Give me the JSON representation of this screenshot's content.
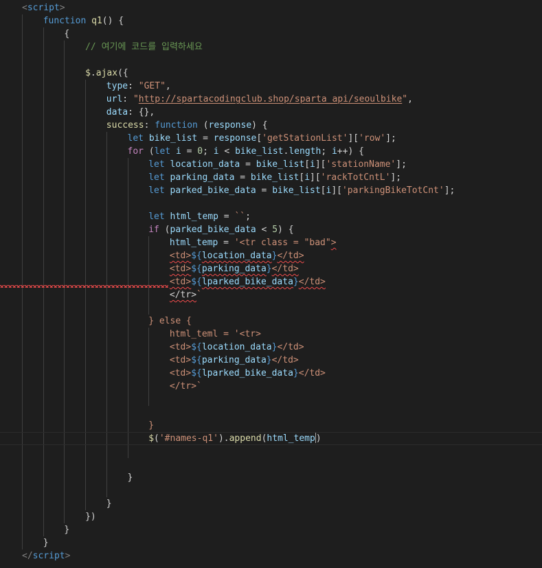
{
  "theme": {
    "background": "#1e1e1e",
    "text": "#d4d4d4",
    "tag": "#569cd6",
    "keyword": "#569cd6",
    "control": "#c586c0",
    "function": "#dcdcaa",
    "variable": "#9cdcfe",
    "string": "#ce9178",
    "number": "#b5cea8",
    "comment": "#6a9955",
    "error": "#f14c4c"
  },
  "code_lines": [
    {
      "indent": 0,
      "tokens": [
        {
          "t": "<",
          "c": "tag-punct"
        },
        {
          "t": "script",
          "c": "tag"
        },
        {
          "t": ">",
          "c": "tag-punct"
        }
      ]
    },
    {
      "indent": 1,
      "tokens": [
        {
          "t": "function",
          "c": "keyword"
        },
        {
          "t": " ",
          "c": "plain"
        },
        {
          "t": "q1",
          "c": "function"
        },
        {
          "t": "() {",
          "c": "plain"
        }
      ]
    },
    {
      "indent": 2,
      "tokens": [
        {
          "t": "{",
          "c": "plain"
        }
      ]
    },
    {
      "indent": 3,
      "tokens": [
        {
          "t": "// 여기에 코드를 입력하세요",
          "c": "comment"
        }
      ]
    },
    {
      "indent": 0,
      "tokens": []
    },
    {
      "indent": 3,
      "tokens": [
        {
          "t": "$",
          "c": "function"
        },
        {
          "t": ".",
          "c": "plain"
        },
        {
          "t": "ajax",
          "c": "function"
        },
        {
          "t": "({",
          "c": "plain"
        }
      ]
    },
    {
      "indent": 4,
      "tokens": [
        {
          "t": "type",
          "c": "variable"
        },
        {
          "t": ": ",
          "c": "plain"
        },
        {
          "t": "\"GET\"",
          "c": "string"
        },
        {
          "t": ",",
          "c": "plain"
        }
      ]
    },
    {
      "indent": 4,
      "tokens": [
        {
          "t": "url",
          "c": "variable"
        },
        {
          "t": ": ",
          "c": "plain"
        },
        {
          "t": "\"",
          "c": "string"
        },
        {
          "t": "http://spartacodingclub.shop/sparta_api/seoulbike",
          "c": "string url"
        },
        {
          "t": "\"",
          "c": "string"
        },
        {
          "t": ",",
          "c": "plain"
        }
      ]
    },
    {
      "indent": 4,
      "tokens": [
        {
          "t": "data",
          "c": "variable"
        },
        {
          "t": ": {},",
          "c": "plain"
        }
      ]
    },
    {
      "indent": 4,
      "tokens": [
        {
          "t": "success",
          "c": "function"
        },
        {
          "t": ": ",
          "c": "plain"
        },
        {
          "t": "function",
          "c": "keyword"
        },
        {
          "t": " (",
          "c": "plain"
        },
        {
          "t": "response",
          "c": "variable"
        },
        {
          "t": ") {",
          "c": "plain"
        }
      ]
    },
    {
      "indent": 5,
      "tokens": [
        {
          "t": "let",
          "c": "keyword"
        },
        {
          "t": " ",
          "c": "plain"
        },
        {
          "t": "bike_list",
          "c": "variable"
        },
        {
          "t": " = ",
          "c": "plain"
        },
        {
          "t": "response",
          "c": "variable"
        },
        {
          "t": "[",
          "c": "plain"
        },
        {
          "t": "'getStationList'",
          "c": "string"
        },
        {
          "t": "][",
          "c": "plain"
        },
        {
          "t": "'row'",
          "c": "string"
        },
        {
          "t": "];",
          "c": "plain"
        }
      ]
    },
    {
      "indent": 5,
      "tokens": [
        {
          "t": "for",
          "c": "control"
        },
        {
          "t": " (",
          "c": "plain"
        },
        {
          "t": "let",
          "c": "keyword"
        },
        {
          "t": " ",
          "c": "plain"
        },
        {
          "t": "i",
          "c": "variable"
        },
        {
          "t": " = ",
          "c": "plain"
        },
        {
          "t": "0",
          "c": "number"
        },
        {
          "t": "; ",
          "c": "plain"
        },
        {
          "t": "i",
          "c": "variable"
        },
        {
          "t": " < ",
          "c": "plain"
        },
        {
          "t": "bike_list",
          "c": "variable"
        },
        {
          "t": ".",
          "c": "plain"
        },
        {
          "t": "length",
          "c": "variable"
        },
        {
          "t": "; ",
          "c": "plain"
        },
        {
          "t": "i",
          "c": "variable"
        },
        {
          "t": "++) {",
          "c": "plain"
        }
      ]
    },
    {
      "indent": 6,
      "tokens": [
        {
          "t": "let",
          "c": "keyword"
        },
        {
          "t": " ",
          "c": "plain"
        },
        {
          "t": "location_data",
          "c": "variable"
        },
        {
          "t": " = ",
          "c": "plain"
        },
        {
          "t": "bike_list",
          "c": "variable"
        },
        {
          "t": "[",
          "c": "plain"
        },
        {
          "t": "i",
          "c": "variable"
        },
        {
          "t": "][",
          "c": "plain"
        },
        {
          "t": "'stationName'",
          "c": "string"
        },
        {
          "t": "];",
          "c": "plain"
        }
      ]
    },
    {
      "indent": 6,
      "tokens": [
        {
          "t": "let",
          "c": "keyword"
        },
        {
          "t": " ",
          "c": "plain"
        },
        {
          "t": "parking_data",
          "c": "variable"
        },
        {
          "t": " = ",
          "c": "plain"
        },
        {
          "t": "bike_list",
          "c": "variable"
        },
        {
          "t": "[",
          "c": "plain"
        },
        {
          "t": "i",
          "c": "variable"
        },
        {
          "t": "][",
          "c": "plain"
        },
        {
          "t": "'rackTotCntL'",
          "c": "string"
        },
        {
          "t": "];",
          "c": "plain"
        }
      ]
    },
    {
      "indent": 6,
      "tokens": [
        {
          "t": "let",
          "c": "keyword"
        },
        {
          "t": " ",
          "c": "plain"
        },
        {
          "t": "parked_bike_data",
          "c": "variable"
        },
        {
          "t": " = ",
          "c": "plain"
        },
        {
          "t": "bike_list",
          "c": "variable"
        },
        {
          "t": "[",
          "c": "plain"
        },
        {
          "t": "i",
          "c": "variable"
        },
        {
          "t": "][",
          "c": "plain"
        },
        {
          "t": "'parkingBikeTotCnt'",
          "c": "string"
        },
        {
          "t": "];",
          "c": "plain"
        }
      ]
    },
    {
      "indent": 0,
      "tokens": []
    },
    {
      "indent": 6,
      "tokens": [
        {
          "t": "let",
          "c": "keyword"
        },
        {
          "t": " ",
          "c": "plain"
        },
        {
          "t": "html_temp",
          "c": "variable"
        },
        {
          "t": " = ",
          "c": "plain"
        },
        {
          "t": "``",
          "c": "string"
        },
        {
          "t": ";",
          "c": "plain"
        }
      ]
    },
    {
      "indent": 6,
      "tokens": [
        {
          "t": "if",
          "c": "control"
        },
        {
          "t": " (",
          "c": "plain"
        },
        {
          "t": "parked_bike_data",
          "c": "variable"
        },
        {
          "t": " < ",
          "c": "plain"
        },
        {
          "t": "5",
          "c": "number"
        },
        {
          "t": ") {",
          "c": "plain"
        }
      ]
    },
    {
      "indent": 7,
      "tokens": [
        {
          "t": "html_temp",
          "c": "variable"
        },
        {
          "t": " = ",
          "c": "plain"
        },
        {
          "t": "'<tr class = \"bad\"",
          "c": "string"
        },
        {
          "t": ">",
          "c": "string squiggle"
        }
      ]
    },
    {
      "indent": 7,
      "tokens": [
        {
          "t": "<td>",
          "c": "string squiggle"
        },
        {
          "t": "${",
          "c": "keyword"
        },
        {
          "t": "location_data",
          "c": "variable squiggle"
        },
        {
          "t": "}",
          "c": "keyword"
        },
        {
          "t": "</td>",
          "c": "string squiggle"
        }
      ]
    },
    {
      "indent": 7,
      "tokens": [
        {
          "t": "<td>",
          "c": "string squiggle"
        },
        {
          "t": "${",
          "c": "keyword"
        },
        {
          "t": "parking_data",
          "c": "variable squiggle"
        },
        {
          "t": "}",
          "c": "keyword"
        },
        {
          "t": "</td>",
          "c": "string squiggle"
        }
      ]
    },
    {
      "indent": 7,
      "tokens": [
        {
          "t": "<td>",
          "c": "string squiggle"
        },
        {
          "t": "${",
          "c": "keyword"
        },
        {
          "t": "lparked_bike_data",
          "c": "variable squiggle"
        },
        {
          "t": "}",
          "c": "keyword"
        },
        {
          "t": "</td>",
          "c": "string squiggle"
        }
      ]
    },
    {
      "indent": 7,
      "tokens": [
        {
          "t": "</tr>",
          "c": "plain squiggle"
        },
        {
          "t": "`",
          "c": "string"
        }
      ]
    },
    {
      "indent": 0,
      "tokens": []
    },
    {
      "indent": 6,
      "tokens": [
        {
          "t": "} ",
          "c": "string"
        },
        {
          "t": "else",
          "c": "string"
        },
        {
          "t": " {",
          "c": "string"
        }
      ]
    },
    {
      "indent": 7,
      "tokens": [
        {
          "t": "html_teml = '<tr>",
          "c": "string"
        }
      ]
    },
    {
      "indent": 7,
      "tokens": [
        {
          "t": "<td>",
          "c": "string"
        },
        {
          "t": "${",
          "c": "keyword"
        },
        {
          "t": "location_data",
          "c": "variable"
        },
        {
          "t": "}",
          "c": "keyword"
        },
        {
          "t": "</td>",
          "c": "string"
        }
      ]
    },
    {
      "indent": 7,
      "tokens": [
        {
          "t": "<td>",
          "c": "string"
        },
        {
          "t": "${",
          "c": "keyword"
        },
        {
          "t": "parking_data",
          "c": "variable"
        },
        {
          "t": "}",
          "c": "keyword"
        },
        {
          "t": "</td>",
          "c": "string"
        }
      ]
    },
    {
      "indent": 7,
      "tokens": [
        {
          "t": "<td>",
          "c": "string"
        },
        {
          "t": "${",
          "c": "keyword"
        },
        {
          "t": "lparked_bike_data",
          "c": "variable"
        },
        {
          "t": "}",
          "c": "keyword"
        },
        {
          "t": "</td>",
          "c": "string"
        }
      ]
    },
    {
      "indent": 7,
      "tokens": [
        {
          "t": "</tr>`",
          "c": "string"
        }
      ]
    },
    {
      "indent": 0,
      "tokens": []
    },
    {
      "indent": 0,
      "tokens": []
    },
    {
      "indent": 6,
      "tokens": [
        {
          "t": "}",
          "c": "string"
        }
      ]
    },
    {
      "indent": 6,
      "current": true,
      "cursor_after": 9,
      "tokens": [
        {
          "t": "$",
          "c": "function"
        },
        {
          "t": "(",
          "c": "plain"
        },
        {
          "t": "'#names-q1'",
          "c": "string"
        },
        {
          "t": ").",
          "c": "plain"
        },
        {
          "t": "append",
          "c": "function"
        },
        {
          "t": "(",
          "c": "plain"
        },
        {
          "t": "html_temp",
          "c": "variable"
        },
        {
          "t": ")",
          "c": "plain"
        }
      ]
    },
    {
      "indent": 0,
      "tokens": []
    },
    {
      "indent": 0,
      "tokens": []
    },
    {
      "indent": 5,
      "tokens": [
        {
          "t": "}",
          "c": "plain"
        }
      ]
    },
    {
      "indent": 0,
      "tokens": []
    },
    {
      "indent": 4,
      "tokens": [
        {
          "t": "}",
          "c": "plain"
        }
      ]
    },
    {
      "indent": 3,
      "tokens": [
        {
          "t": "})",
          "c": "plain"
        }
      ]
    },
    {
      "indent": 2,
      "tokens": [
        {
          "t": "}",
          "c": "plain"
        }
      ]
    },
    {
      "indent": 1,
      "tokens": [
        {
          "t": "}",
          "c": "plain"
        }
      ]
    },
    {
      "indent": 0,
      "tokens": [
        {
          "t": "</",
          "c": "tag-punct"
        },
        {
          "t": "script",
          "c": "tag"
        },
        {
          "t": ">",
          "c": "tag-punct"
        }
      ]
    }
  ]
}
